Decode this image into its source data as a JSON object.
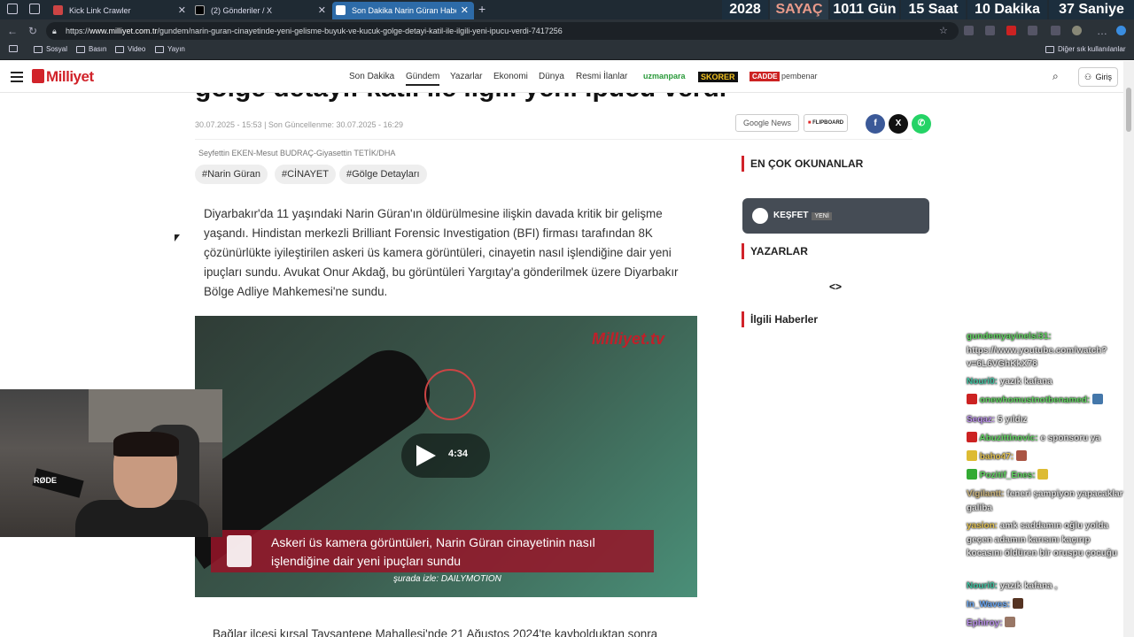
{
  "tabs": [
    {
      "title": "Kick Link Crawler",
      "active": false
    },
    {
      "title": "(2) Gönderiler / X",
      "active": false
    },
    {
      "title": "Son Dakika Narin Güran Haberleri",
      "active": true
    }
  ],
  "counter": {
    "year": "2028",
    "label": "SAYAÇ",
    "days": "1011 Gün",
    "hours": "15 Saat",
    "minutes": "10 Dakika",
    "seconds": "37 Saniye"
  },
  "address": {
    "scheme": "https://",
    "host": "www.milliyet.com.tr",
    "path": "/gundem/narin-guran-cinayetinde-yeni-gelisme-buyuk-ve-kucuk-golge-detayi-katil-ile-ilgili-yeni-ipucu-verdi-7417256"
  },
  "bookmarks": [
    "Sosyal",
    "Basın",
    "Video",
    "Yayın"
  ],
  "bookmarks_other": "Diğer sık kullanılanlar",
  "site": {
    "logo": "Milliyet",
    "nav": [
      "Son Dakika",
      "Gündem",
      "Yazarlar",
      "Ekonomi",
      "Dünya",
      "Resmi İlanlar"
    ],
    "active_nav": "Gündem",
    "brands": [
      "uzmanpara",
      "SKORER",
      "CADDE",
      "pembenar"
    ],
    "login": "Giriş"
  },
  "article": {
    "title_partial": "gölge detayı: katil ile ilgili yeni ipucu verdi",
    "date": "30.07.2025 - 15:53 | Son Güncellenme: 30.07.2025 - 16:29",
    "share": {
      "google_news": "Google News",
      "flipboard": "FLIPBOARD"
    },
    "author": "Seyfettin EKEN-Mesut BUDRAÇ-Giyasettin TETİK/DHA",
    "tags": [
      "#Narin Güran",
      "#CİNAYET",
      "#Gölge Detayları"
    ],
    "lead": "Diyarbakır'da 11 yaşındaki Narin Güran'ın öldürülmesine ilişkin davada kritik bir gelişme yaşandı. Hindistan merkezli Brilliant Forensic Investigation (BFI) firması tarafından 8K çözünürlükte iyileştirilen askeri üs kamera görüntüleri, cinayetin nasıl işlendiğine dair yeni ipuçları sundu. Avukat Onur Akdağ, bu görüntüleri Yargıtay'a gönderilmek üzere Diyarbakır Bölge Adliye Mahkemesi'ne sundu.",
    "video": {
      "logo": "Milliyet.tv",
      "duration": "4:34",
      "caption_line1": "Askeri üs kamera görüntüleri, Narin Güran cinayetinin nasıl",
      "caption_line2": "işlendiğine dair yeni ipuçları sundu",
      "source": "şurada izle: DAILYMOTION"
    },
    "next_paragraph": "Bağlar ilçesi kırsal Tavşantepe Mahallesi'nde 21 Ağustos 2024'te kaybolduktan sonra"
  },
  "sidebar": {
    "most_read": "EN ÇOK OKUNANLAR",
    "kesfet": "KEŞFET",
    "kesfet_badge": "YENİ",
    "writers": "YAZARLAR",
    "arrows": "<>",
    "related": "İlgili Haberler"
  },
  "chat": [
    {
      "user": "gundemyayinelsi31:",
      "text": "https://www.youtube.com/watch?v=6L6VGhKkX78",
      "color": "#5fd35f"
    },
    {
      "user": "Nouri0:",
      "text": "yazık kafana",
      "color": "#3fc2a0"
    },
    {
      "user": "onewhomustnotbenamed:",
      "text": "",
      "color": "#5fd35f"
    },
    {
      "user": "Seqaz:",
      "text": "5 yıldız",
      "color": "#b88ee8"
    },
    {
      "user": "Abuzittinovic:",
      "text": "e sponsoru ya",
      "color": "#5fd35f"
    },
    {
      "user": "baho47:",
      "text": "",
      "color": "#e0c050"
    },
    {
      "user": "Pozitif_Enes:",
      "text": "",
      "color": "#5fd35f"
    },
    {
      "user": "Vigilantt:",
      "text": "feneri şampiyon yapacaklar galiba",
      "color": "#c9b27a"
    },
    {
      "user": "yasion:",
      "text": "amk saddamın oğlu yolda geçen adamın karısını kaçırıp kocasını öldüren bir oruspu çocuğu",
      "color": "#e0c050"
    },
    {
      "user": "Nouri0:",
      "text": "yazık kafana ,",
      "color": "#3fc2a0"
    },
    {
      "user": "In_Waves:",
      "text": "",
      "color": "#6aa6f0"
    },
    {
      "user": "Ephiroy:",
      "text": "",
      "color": "#b88ee8"
    }
  ],
  "colors": {
    "brand_red": "#d1232a",
    "tab_active": "#2d6ba8"
  }
}
